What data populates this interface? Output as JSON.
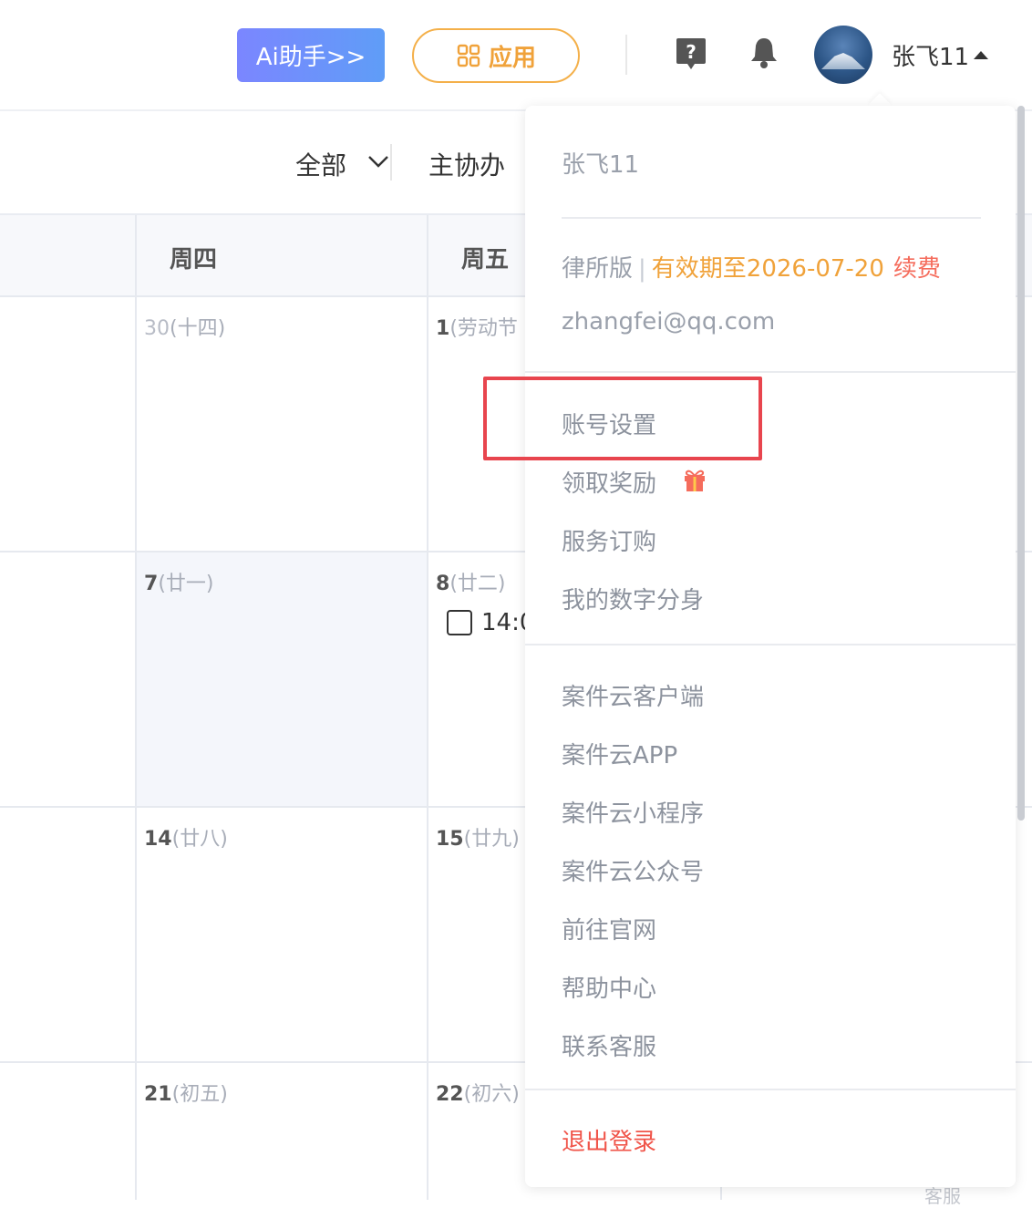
{
  "header": {
    "ai_button": "Ai助手>>",
    "app_button": "应用",
    "user_name": "张飞11"
  },
  "toolbar": {
    "filter_all": "全部",
    "filter_main": "主协办"
  },
  "calendar": {
    "weekdays": [
      "周四",
      "周五"
    ],
    "days": [
      {
        "num": "30",
        "lunar": "(十四)"
      },
      {
        "num": "1",
        "lunar": "(劳动节"
      },
      {
        "num": "7",
        "lunar": "(廿一)"
      },
      {
        "num": "8",
        "lunar": "(廿二)"
      },
      {
        "num": "14",
        "lunar": "(廿八)"
      },
      {
        "num": "15",
        "lunar": "(廿九)"
      },
      {
        "num": "21",
        "lunar": "(初五)"
      },
      {
        "num": "22",
        "lunar": "(初六)"
      }
    ],
    "event_time": "14:0",
    "footer_peek": "客服"
  },
  "menu": {
    "name": "张飞11",
    "plan": "律所版",
    "separator": "|",
    "expiry": "有效期至2026-07-20",
    "renew": "续费",
    "email": "zhangfei@qq.com",
    "items_account": [
      "账号设置",
      "领取奖励",
      "服务订购",
      "我的数字分身"
    ],
    "items_links": [
      "案件云客户端",
      "案件云APP",
      "案件云小程序",
      "案件云公众号",
      "前往官网",
      "帮助中心",
      "联系客服"
    ],
    "logout": "退出登录"
  },
  "colors": {
    "accent_orange": "#f0a23a",
    "danger_red": "#f0554a",
    "highlight_box": "#e8454e",
    "ai_gradient_start": "#7b86ff",
    "ai_gradient_end": "#5f9df7"
  }
}
